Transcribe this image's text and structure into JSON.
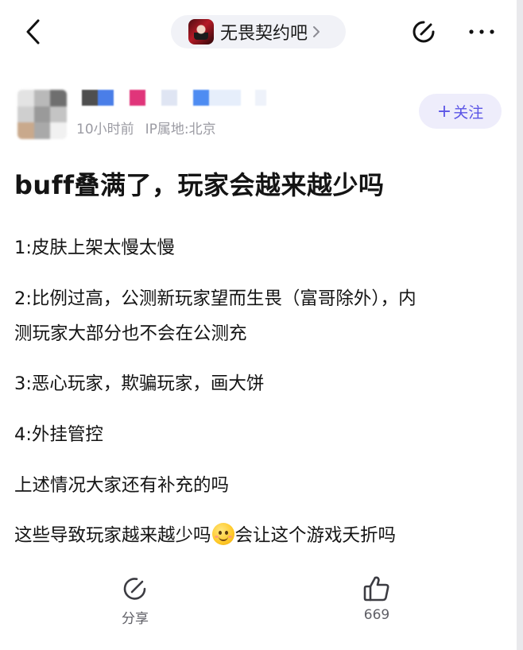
{
  "header": {
    "forum_name": "无畏契约吧",
    "forum_chevron": "›"
  },
  "author": {
    "time": "10小时前",
    "ip_location": "IP属地:北京",
    "follow_label": "关注",
    "follow_plus": "+"
  },
  "post": {
    "title": "buff叠满了，玩家会越来越少吗",
    "lines": [
      "1:皮肤上架太慢太慢",
      "2:比例过高，公测新玩家望而生畏（富哥除外），内",
      "测玩家大部分也不会在公测充",
      "3:恶心玩家，欺骗玩家，画大饼",
      "4:外挂管控",
      "上述情况大家还有补充的吗"
    ],
    "last_line_before_emoji": "这些导致玩家越来越少吗",
    "last_line_after_emoji": "会让这个游戏夭折吗"
  },
  "actions": {
    "share_label": "分享",
    "like_count": "669"
  },
  "icons": {
    "back": "chevron-left-icon",
    "share_top": "share-icon",
    "more": "more-icon",
    "share_bottom": "share-icon",
    "like": "thumbs-up-icon",
    "emoji": "smiling-face-emoji-icon"
  },
  "colors": {
    "accent": "#5b55e6",
    "follow_bg": "#eeedfb",
    "pill_bg": "#f1f2f7",
    "meta_text": "#9b9ba3"
  }
}
